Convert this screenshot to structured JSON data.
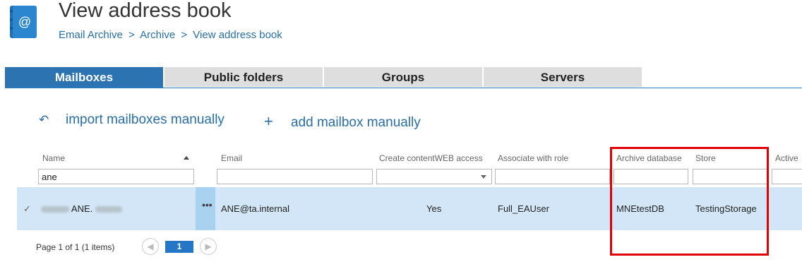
{
  "header": {
    "title": "View address book",
    "breadcrumb": [
      "Email Archive",
      ">",
      "Archive",
      ">",
      "View address book"
    ],
    "icon": "address-book-icon"
  },
  "tabs": [
    {
      "label": "Mailboxes",
      "active": true
    },
    {
      "label": "Public folders",
      "active": false
    },
    {
      "label": "Groups",
      "active": false
    },
    {
      "label": "Servers",
      "active": false
    }
  ],
  "actions": {
    "import_label": "import mailboxes manually",
    "import_icon": "undo-arrow-icon",
    "add_label": "add mailbox manually",
    "add_icon": "plus-icon"
  },
  "grid": {
    "columns": {
      "name": "Name",
      "email": "Email",
      "access": "Create contentWEB access",
      "role": "Associate with role",
      "archive_db": "Archive database",
      "store": "Store",
      "active": "Active"
    },
    "filters": {
      "name": "ane",
      "email": "",
      "access": "",
      "role": "",
      "archive_db": "",
      "store": ""
    },
    "rows": [
      {
        "checked": "✓",
        "name_visible": "ANE.",
        "actions": "•••",
        "email": "ANE@ta.internal",
        "access": "Yes",
        "role": "Full_EAUser",
        "archive_db": "MNEtestDB",
        "store": "TestingStorage"
      }
    ]
  },
  "pager": {
    "summary": "Page 1 of 1 (1 items)",
    "current_page": "1",
    "prev": "◀",
    "next": "▶"
  },
  "colors": {
    "accent": "#2c73b2",
    "link": "#2a6ea6",
    "row_selected": "#d3e6f7",
    "highlight": "#e00000"
  }
}
